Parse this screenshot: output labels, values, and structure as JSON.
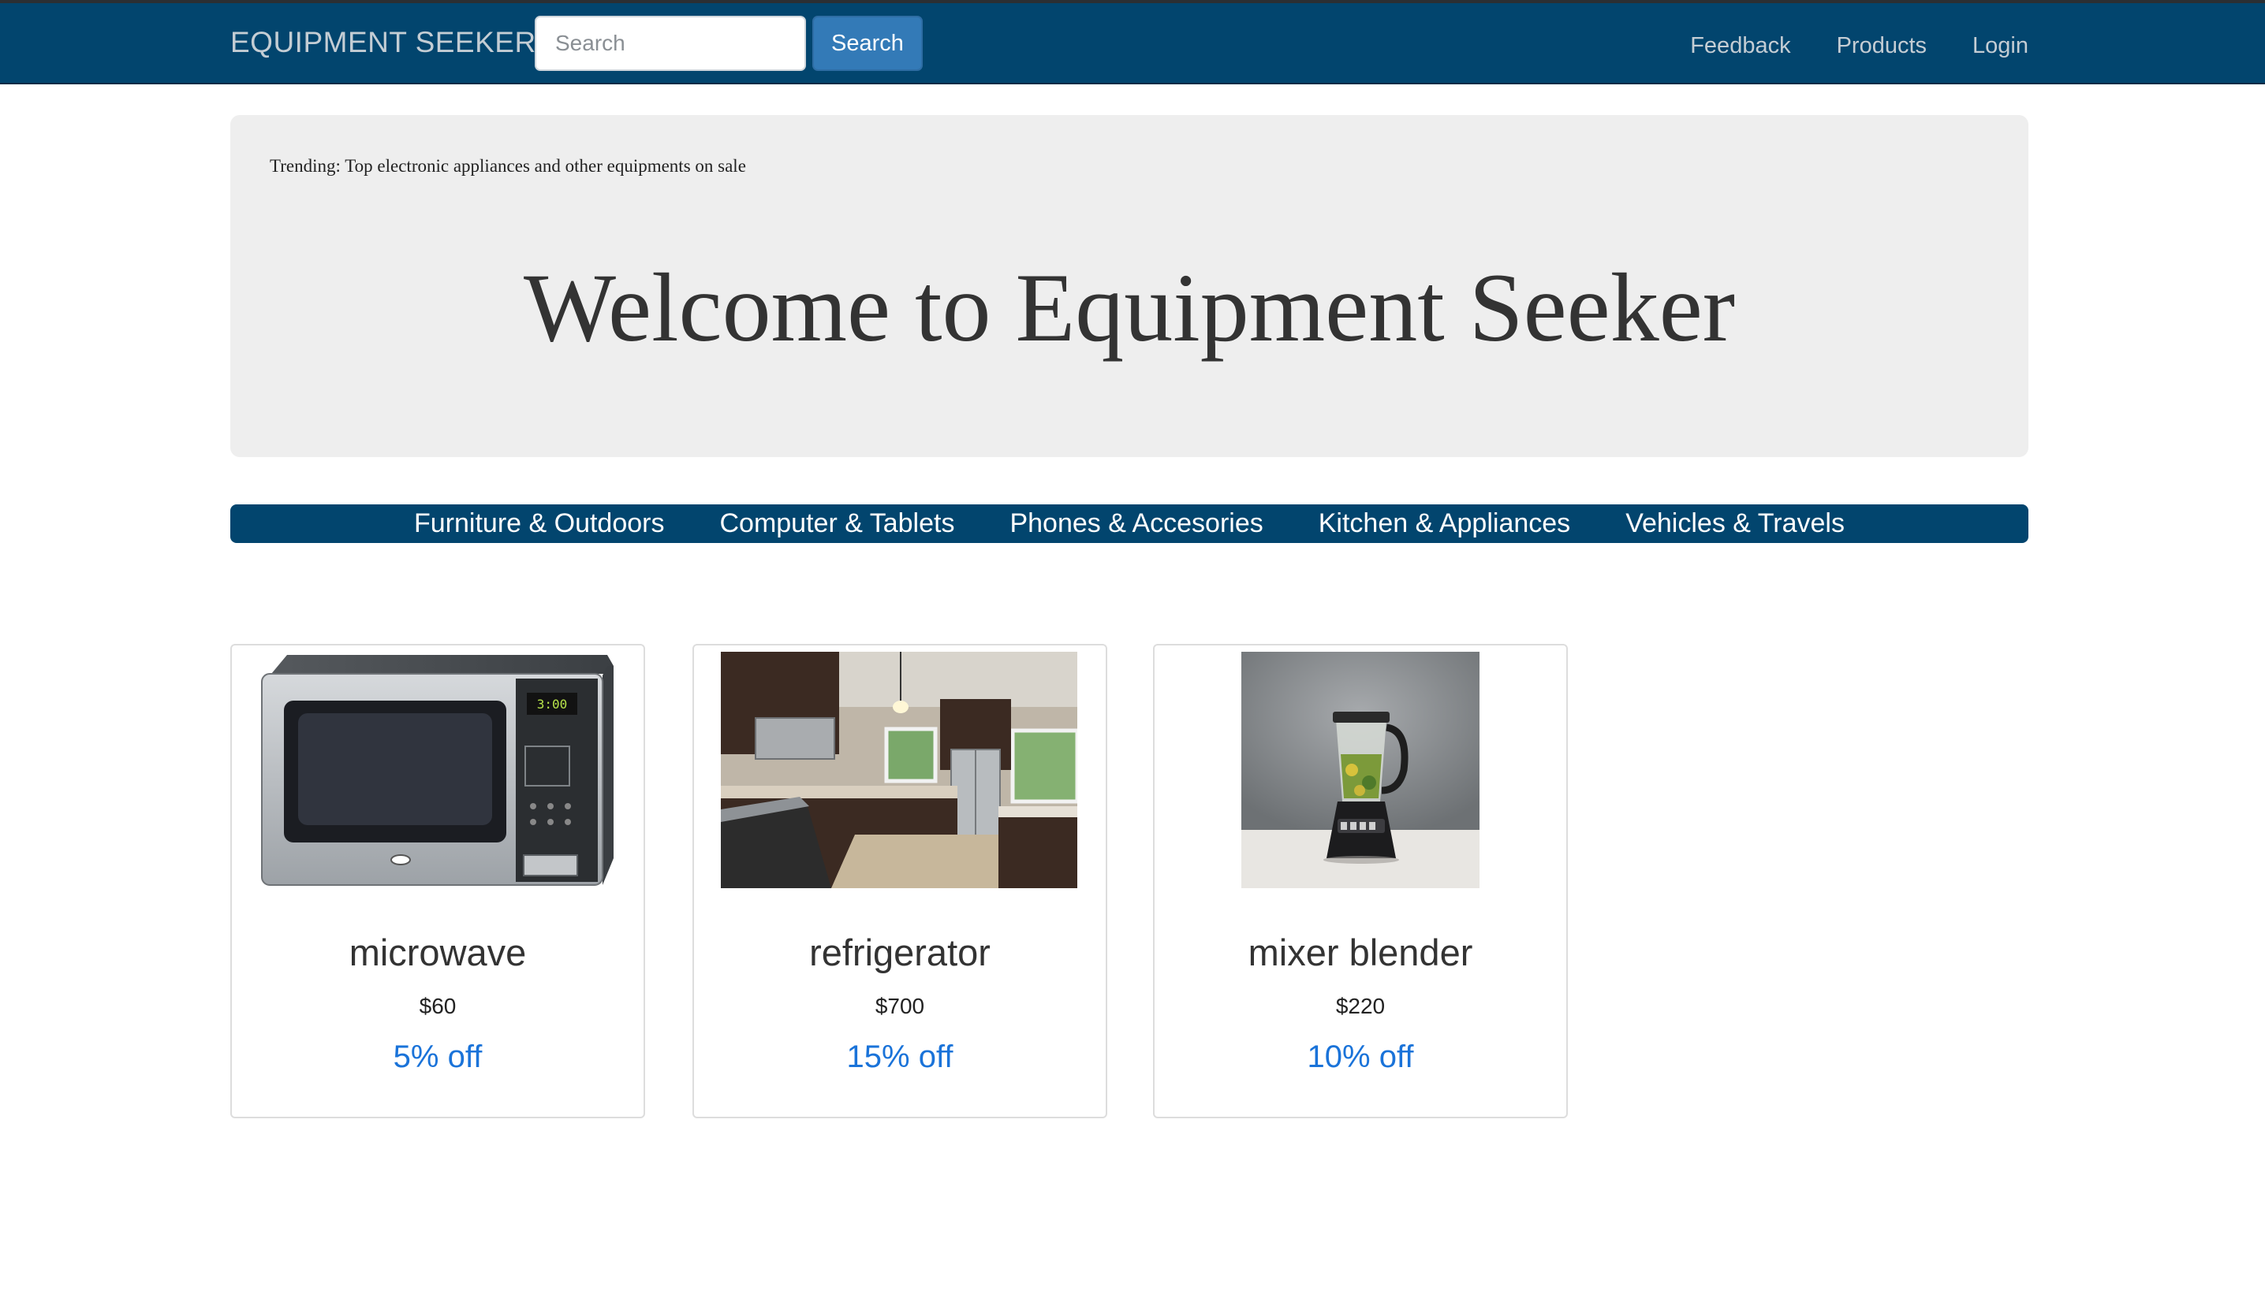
{
  "header": {
    "brand": "EQUIPMENT SEEKER",
    "search": {
      "placeholder": "Search",
      "value": "",
      "button_label": "Search"
    },
    "nav": [
      "Feedback",
      "Products",
      "Login"
    ]
  },
  "hero": {
    "trending": "Trending: Top electronic appliances and other equipments on sale",
    "title": "Welcome to Equipment Seeker"
  },
  "categories": [
    "Furniture & Outdoors",
    "Computer & Tablets",
    "Phones & Accesories",
    "Kitchen & Appliances",
    "Vehicles & Travels"
  ],
  "products": [
    {
      "name": "microwave",
      "price": "$60",
      "discount": "5% off",
      "image": "microwave-photo",
      "display_time": "3:00"
    },
    {
      "name": "refrigerator",
      "price": "$700",
      "discount": "15% off",
      "image": "kitchen-refrigerator-photo"
    },
    {
      "name": "mixer blender",
      "price": "$220",
      "discount": "10% off",
      "image": "blender-photo"
    }
  ],
  "colors": {
    "navbar": "#02456e",
    "search_button": "#337ab7",
    "discount": "#1a73d9",
    "jumbotron": "#eeeeee"
  }
}
